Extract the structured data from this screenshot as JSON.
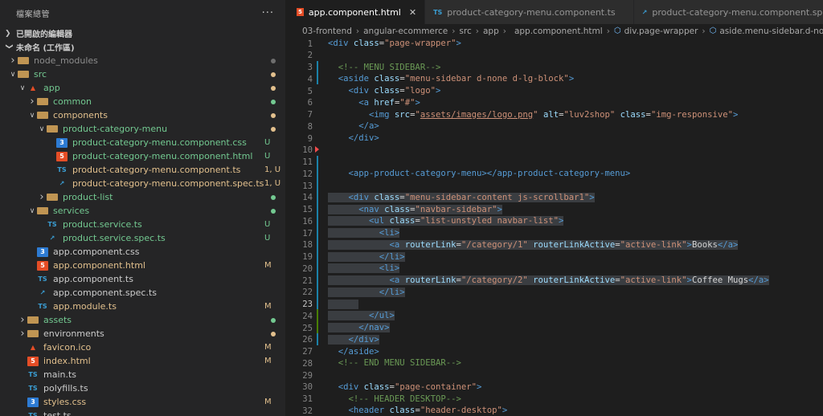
{
  "sidebar": {
    "title": "檔案總管",
    "more_icon": "ellipsis-icon",
    "open_editors_label": "已開啟的編輯器",
    "workspace_label": "未命名 (工作區)",
    "tree": [
      {
        "label": "node_modules",
        "depth": 1,
        "twist": "closed",
        "icon": "folder",
        "color": "grey",
        "badge": "",
        "dot": "grey"
      },
      {
        "label": "src",
        "depth": 1,
        "twist": "open",
        "icon": "folder",
        "color": "green",
        "badge": "",
        "dot": "yellow"
      },
      {
        "label": "app",
        "depth": 2,
        "twist": "open",
        "icon": "angular",
        "color": "green",
        "badge": "",
        "dot": "yellow"
      },
      {
        "label": "common",
        "depth": 3,
        "twist": "closed",
        "icon": "folder",
        "color": "green",
        "badge": "",
        "dot": "green"
      },
      {
        "label": "components",
        "depth": 3,
        "twist": "open",
        "icon": "folder",
        "color": "yellow",
        "badge": "",
        "dot": "yellow"
      },
      {
        "label": "product-category-menu",
        "depth": 4,
        "twist": "open",
        "icon": "folder",
        "color": "green",
        "badge": "",
        "dot": "yellow"
      },
      {
        "label": "product-category-menu.component.css",
        "depth": 5,
        "twist": "",
        "icon": "css",
        "color": "green",
        "badge": "U",
        "dot": ""
      },
      {
        "label": "product-category-menu.component.html",
        "depth": 5,
        "twist": "",
        "icon": "html",
        "color": "green",
        "badge": "U",
        "dot": ""
      },
      {
        "label": "product-category-menu.component.ts",
        "depth": 5,
        "twist": "",
        "icon": "ts",
        "color": "yellow",
        "badge": "1, U",
        "dot": ""
      },
      {
        "label": "product-category-menu.component.spec.ts",
        "depth": 5,
        "twist": "",
        "icon": "spec",
        "color": "yellow",
        "badge": "1, U",
        "dot": ""
      },
      {
        "label": "product-list",
        "depth": 4,
        "twist": "closed",
        "icon": "folder",
        "color": "green",
        "badge": "",
        "dot": "green"
      },
      {
        "label": "services",
        "depth": 3,
        "twist": "open",
        "icon": "folder",
        "color": "green",
        "badge": "",
        "dot": "green"
      },
      {
        "label": "product.service.ts",
        "depth": 4,
        "twist": "",
        "icon": "ts",
        "color": "green",
        "badge": "U",
        "dot": ""
      },
      {
        "label": "product.service.spec.ts",
        "depth": 4,
        "twist": "",
        "icon": "spec",
        "color": "green",
        "badge": "U",
        "dot": ""
      },
      {
        "label": "app.component.css",
        "depth": 3,
        "twist": "",
        "icon": "css",
        "color": "white",
        "badge": "",
        "dot": ""
      },
      {
        "label": "app.component.html",
        "depth": 3,
        "twist": "",
        "icon": "html",
        "color": "yellow",
        "badge": "M",
        "dot": ""
      },
      {
        "label": "app.component.ts",
        "depth": 3,
        "twist": "",
        "icon": "ts",
        "color": "white",
        "badge": "",
        "dot": ""
      },
      {
        "label": "app.component.spec.ts",
        "depth": 3,
        "twist": "",
        "icon": "spec",
        "color": "white",
        "badge": "",
        "dot": ""
      },
      {
        "label": "app.module.ts",
        "depth": 3,
        "twist": "",
        "icon": "ts",
        "color": "yellow",
        "badge": "M",
        "dot": ""
      },
      {
        "label": "assets",
        "depth": 2,
        "twist": "closed",
        "icon": "folder",
        "color": "green",
        "badge": "",
        "dot": "green"
      },
      {
        "label": "environments",
        "depth": 2,
        "twist": "closed",
        "icon": "folder",
        "color": "white",
        "badge": "",
        "dot": "yellow"
      },
      {
        "label": "favicon.ico",
        "depth": 2,
        "twist": "",
        "icon": "angular",
        "color": "yellow",
        "badge": "M",
        "dot": ""
      },
      {
        "label": "index.html",
        "depth": 2,
        "twist": "",
        "icon": "html",
        "color": "yellow",
        "badge": "M",
        "dot": ""
      },
      {
        "label": "main.ts",
        "depth": 2,
        "twist": "",
        "icon": "ts",
        "color": "white",
        "badge": "",
        "dot": ""
      },
      {
        "label": "polyfills.ts",
        "depth": 2,
        "twist": "",
        "icon": "ts",
        "color": "white",
        "badge": "",
        "dot": ""
      },
      {
        "label": "styles.css",
        "depth": 2,
        "twist": "",
        "icon": "css",
        "color": "yellow",
        "badge": "M",
        "dot": ""
      },
      {
        "label": "test.ts",
        "depth": 2,
        "twist": "",
        "icon": "ts",
        "color": "white",
        "badge": "",
        "dot": ""
      }
    ]
  },
  "editor": {
    "tabs": [
      {
        "label": "app.component.html",
        "icon": "html",
        "active": true
      },
      {
        "label": "product-category-menu.component.ts",
        "icon": "ts",
        "active": false
      },
      {
        "label": "product-category-menu.component.spec.ts",
        "icon": "spec",
        "active": false
      }
    ],
    "breadcrumb": [
      "03-frontend",
      "angular-ecommerce",
      "src",
      "app",
      "app.component.html",
      "div.page-wrapper",
      "aside.menu-sidebar.d-none.d-lg-block"
    ],
    "lines": [
      {
        "n": "1",
        "g": "",
        "ind": 0,
        "sel": false,
        "p": [
          [
            "t",
            "<div "
          ],
          [
            "a",
            "class"
          ],
          [
            "x",
            "="
          ],
          [
            "s",
            "\"page-wrapper\""
          ],
          [
            "t",
            ">"
          ]
        ]
      },
      {
        "n": "2",
        "g": "",
        "ind": 0,
        "sel": false,
        "p": []
      },
      {
        "n": "3",
        "g": "blue",
        "ind": 2,
        "sel": false,
        "p": [
          [
            "c",
            "<!-- MENU SIDEBAR-->"
          ]
        ]
      },
      {
        "n": "4",
        "g": "blue",
        "ind": 2,
        "sel": false,
        "p": [
          [
            "t",
            "<aside "
          ],
          [
            "a",
            "class"
          ],
          [
            "x",
            "="
          ],
          [
            "s",
            "\"menu-sidebar d-none d-lg-block\""
          ],
          [
            "t",
            ">"
          ]
        ]
      },
      {
        "n": "5",
        "g": "",
        "ind": 4,
        "sel": false,
        "p": [
          [
            "t",
            "<div "
          ],
          [
            "a",
            "class"
          ],
          [
            "x",
            "="
          ],
          [
            "s",
            "\"logo\""
          ],
          [
            "t",
            ">"
          ]
        ]
      },
      {
        "n": "6",
        "g": "",
        "ind": 6,
        "sel": false,
        "p": [
          [
            "t",
            "<a "
          ],
          [
            "a",
            "href"
          ],
          [
            "x",
            "="
          ],
          [
            "s",
            "\"#\""
          ],
          [
            "t",
            ">"
          ]
        ]
      },
      {
        "n": "7",
        "g": "",
        "ind": 8,
        "sel": false,
        "p": [
          [
            "t",
            "<img "
          ],
          [
            "a",
            "src"
          ],
          [
            "x",
            "="
          ],
          [
            "s",
            "\""
          ],
          [
            "u",
            "assets/images/logo.png"
          ],
          [
            "s",
            "\""
          ],
          [
            "x",
            " "
          ],
          [
            "a",
            "alt"
          ],
          [
            "x",
            "="
          ],
          [
            "s",
            "\"luv2shop\""
          ],
          [
            "x",
            " "
          ],
          [
            "a",
            "class"
          ],
          [
            "x",
            "="
          ],
          [
            "s",
            "\"img-responsive\""
          ],
          [
            "t",
            ">"
          ]
        ]
      },
      {
        "n": "8",
        "g": "",
        "ind": 6,
        "sel": false,
        "p": [
          [
            "t",
            "</a>"
          ]
        ]
      },
      {
        "n": "9",
        "g": "",
        "ind": 4,
        "sel": false,
        "p": [
          [
            "t",
            "</div>"
          ]
        ]
      },
      {
        "n": "10",
        "g": "red",
        "ind": 0,
        "sel": false,
        "p": []
      },
      {
        "n": "11",
        "g": "blue",
        "ind": 0,
        "sel": false,
        "p": []
      },
      {
        "n": "12",
        "g": "blue",
        "ind": 4,
        "sel": false,
        "p": [
          [
            "t",
            "<app-product-category-menu></app-product-category-menu>"
          ]
        ]
      },
      {
        "n": "13",
        "g": "blue",
        "ind": 0,
        "sel": false,
        "p": []
      },
      {
        "n": "14",
        "g": "blue",
        "ind": 4,
        "sel": true,
        "p": [
          [
            "t",
            "<div "
          ],
          [
            "a",
            "class"
          ],
          [
            "x",
            "="
          ],
          [
            "s",
            "\"menu-sidebar-content js-scrollbar1\""
          ],
          [
            "t",
            ">"
          ]
        ]
      },
      {
        "n": "15",
        "g": "blue",
        "ind": 6,
        "sel": true,
        "p": [
          [
            "t",
            "<nav "
          ],
          [
            "a",
            "class"
          ],
          [
            "x",
            "="
          ],
          [
            "s",
            "\"navbar-sidebar\""
          ],
          [
            "t",
            ">"
          ]
        ]
      },
      {
        "n": "16",
        "g": "blue",
        "ind": 8,
        "sel": true,
        "p": [
          [
            "t",
            "<ul "
          ],
          [
            "a",
            "class"
          ],
          [
            "x",
            "="
          ],
          [
            "s",
            "\"list-unstyled navbar-list\""
          ],
          [
            "t",
            ">"
          ]
        ]
      },
      {
        "n": "17",
        "g": "blue",
        "ind": 10,
        "sel": true,
        "p": [
          [
            "t",
            "<li>"
          ]
        ]
      },
      {
        "n": "18",
        "g": "blue",
        "ind": 12,
        "sel": true,
        "p": [
          [
            "t",
            "<a "
          ],
          [
            "a",
            "routerLink"
          ],
          [
            "x",
            "="
          ],
          [
            "s",
            "\"/category/1\""
          ],
          [
            "x",
            " "
          ],
          [
            "a",
            "routerLinkActive"
          ],
          [
            "x",
            "="
          ],
          [
            "s",
            "\"active-link\""
          ],
          [
            "t",
            ">"
          ],
          [
            "x",
            "Books"
          ],
          [
            "t",
            "</a>"
          ]
        ]
      },
      {
        "n": "19",
        "g": "blue",
        "ind": 10,
        "sel": true,
        "p": [
          [
            "t",
            "</li>"
          ]
        ]
      },
      {
        "n": "20",
        "g": "blue",
        "ind": 10,
        "sel": true,
        "p": [
          [
            "t",
            "<li>"
          ]
        ]
      },
      {
        "n": "21",
        "g": "blue",
        "ind": 12,
        "sel": true,
        "p": [
          [
            "t",
            "<a "
          ],
          [
            "a",
            "routerLink"
          ],
          [
            "x",
            "="
          ],
          [
            "s",
            "\"/category/2\""
          ],
          [
            "x",
            " "
          ],
          [
            "a",
            "routerLinkActive"
          ],
          [
            "x",
            "="
          ],
          [
            "s",
            "\"active-link\""
          ],
          [
            "t",
            ">"
          ],
          [
            "x",
            "Coffee Mugs"
          ],
          [
            "t",
            "</a>"
          ]
        ]
      },
      {
        "n": "22",
        "g": "blue",
        "ind": 10,
        "sel": true,
        "p": [
          [
            "t",
            "</li>"
          ]
        ]
      },
      {
        "n": "23",
        "g": "blue",
        "ind": 2,
        "sel": true,
        "p": [
          [
            "x",
            "    "
          ]
        ]
      },
      {
        "n": "24",
        "g": "green",
        "ind": 8,
        "sel": true,
        "p": [
          [
            "t",
            "</ul>"
          ]
        ]
      },
      {
        "n": "25",
        "g": "green",
        "ind": 6,
        "sel": true,
        "p": [
          [
            "t",
            "</nav>"
          ]
        ]
      },
      {
        "n": "26",
        "g": "blue",
        "ind": 4,
        "sel": true,
        "p": [
          [
            "t",
            "</div>"
          ]
        ]
      },
      {
        "n": "27",
        "g": "",
        "ind": 2,
        "sel": false,
        "p": [
          [
            "t",
            "</aside>"
          ]
        ]
      },
      {
        "n": "28",
        "g": "",
        "ind": 2,
        "sel": false,
        "p": [
          [
            "c",
            "<!-- END MENU SIDEBAR-->"
          ]
        ]
      },
      {
        "n": "29",
        "g": "",
        "ind": 0,
        "sel": false,
        "p": []
      },
      {
        "n": "30",
        "g": "",
        "ind": 2,
        "sel": false,
        "p": [
          [
            "t",
            "<div "
          ],
          [
            "a",
            "class"
          ],
          [
            "x",
            "="
          ],
          [
            "s",
            "\"page-container\""
          ],
          [
            "t",
            ">"
          ]
        ]
      },
      {
        "n": "31",
        "g": "",
        "ind": 4,
        "sel": false,
        "p": [
          [
            "c",
            "<!-- HEADER DESKTOP-->"
          ]
        ]
      },
      {
        "n": "32",
        "g": "",
        "ind": 4,
        "sel": false,
        "p": [
          [
            "t",
            "<header "
          ],
          [
            "a",
            "class"
          ],
          [
            "x",
            "="
          ],
          [
            "s",
            "\"header-desktop\""
          ],
          [
            "t",
            ">"
          ]
        ]
      }
    ]
  },
  "colors": {
    "sidebar_bg": "#252526",
    "editor_bg": "#1e1e1e",
    "untracked_green": "#73c991",
    "modified_yellow": "#e2c08d",
    "gutter_blue": "#1b81a8",
    "gutter_green": "#487e02",
    "gutter_red": "#f14c4c"
  }
}
